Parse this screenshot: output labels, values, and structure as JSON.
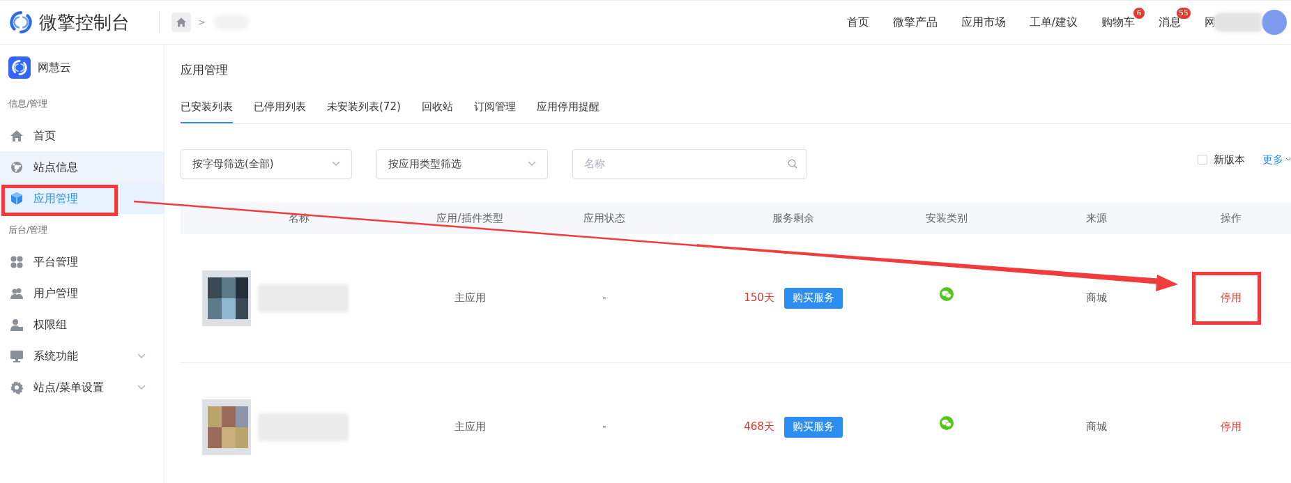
{
  "header": {
    "title": "微擎控制台",
    "breadcrumb_separator": ">",
    "nav": [
      {
        "label": "首页"
      },
      {
        "label": "微擎产品"
      },
      {
        "label": "应用市场"
      },
      {
        "label": "工单/建议"
      },
      {
        "label": "购物车",
        "badge": "6"
      },
      {
        "label": "消息",
        "badge": "55"
      }
    ],
    "user_initial": "网"
  },
  "sidebar": {
    "brand": "网慧云",
    "sections": [
      {
        "title": "信息/管理",
        "items": [
          {
            "label": "首页",
            "selected": false,
            "hovered": false
          },
          {
            "label": "站点信息",
            "selected": false,
            "hovered": true
          },
          {
            "label": "应用管理",
            "selected": true,
            "hovered": false
          }
        ]
      },
      {
        "title": "后台/管理",
        "items": [
          {
            "label": "平台管理",
            "selected": false,
            "hovered": false
          },
          {
            "label": "用户管理",
            "selected": false,
            "hovered": false
          },
          {
            "label": "权限组",
            "selected": false,
            "hovered": false
          },
          {
            "label": "系统功能",
            "selected": false,
            "hovered": false,
            "expanded": false
          },
          {
            "label": "站点/菜单设置",
            "selected": false,
            "hovered": false,
            "expanded": false
          }
        ]
      }
    ]
  },
  "page": {
    "title": "应用管理",
    "tabs": [
      {
        "label": "已安装列表",
        "selected": true
      },
      {
        "label": "已停用列表",
        "selected": false
      },
      {
        "label": "未安装列表(72)",
        "selected": false
      },
      {
        "label": "回收站",
        "selected": false
      },
      {
        "label": "订阅管理",
        "selected": false
      },
      {
        "label": "应用停用提醒",
        "selected": false
      }
    ],
    "filters": {
      "letter_select": "按字母筛选(全部)",
      "type_select": "按应用类型筛选",
      "search": {
        "placeholder": "名称"
      },
      "new_version": {
        "label": "新版本",
        "checked": false
      },
      "more": "更多"
    },
    "table": {
      "columns": [
        "名称",
        "应用/插件类型",
        "应用状态",
        "服务剩余",
        "安装类别",
        "来源",
        "操作"
      ],
      "rows": [
        {
          "type": "主应用",
          "status": "-",
          "remaining": "150天",
          "buy": "购买服务",
          "source": "商城",
          "action": "停用",
          "highlighted": true
        },
        {
          "type": "主应用",
          "status": "-",
          "remaining": "468天",
          "buy": "购买服务",
          "source": "商城",
          "action": "停用",
          "highlighted": false
        }
      ]
    }
  }
}
